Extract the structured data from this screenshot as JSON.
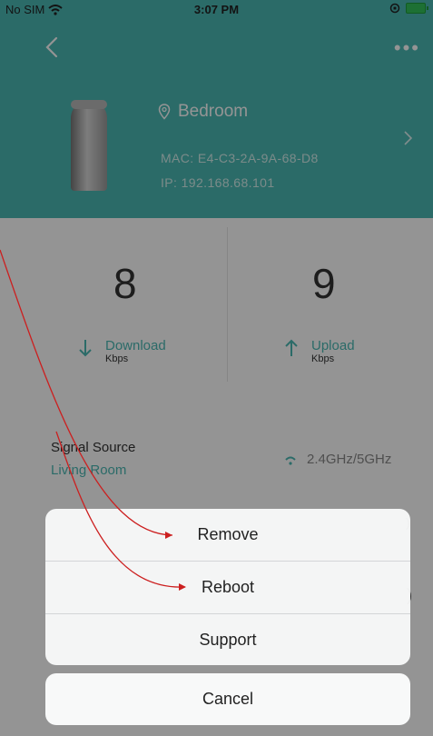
{
  "status_bar": {
    "carrier": "No SIM",
    "time": "3:07 PM"
  },
  "device": {
    "location": "Bedroom",
    "mac": "MAC: E4-C3-2A-9A-68-D8",
    "ip": "IP: 192.168.68.101"
  },
  "stats": {
    "download": {
      "value": "8",
      "label": "Download",
      "unit": "Kbps"
    },
    "upload": {
      "value": "9",
      "label": "Upload",
      "unit": "Kbps"
    }
  },
  "signal": {
    "label": "Signal Source",
    "source": "Living Room",
    "band": "2.4GHz/5GHz"
  },
  "action_sheet": {
    "items": [
      {
        "label": "Remove"
      },
      {
        "label": "Reboot"
      },
      {
        "label": "Support"
      }
    ],
    "cancel_label": "Cancel"
  },
  "colors": {
    "accent": "#4ab8b4",
    "annotation": "#cc1f1f"
  },
  "icons": [
    "wifi-icon",
    "back-icon",
    "more-icon",
    "location-pin-icon",
    "chevron-right-icon",
    "download-arrow-icon",
    "upload-arrow-icon"
  ]
}
